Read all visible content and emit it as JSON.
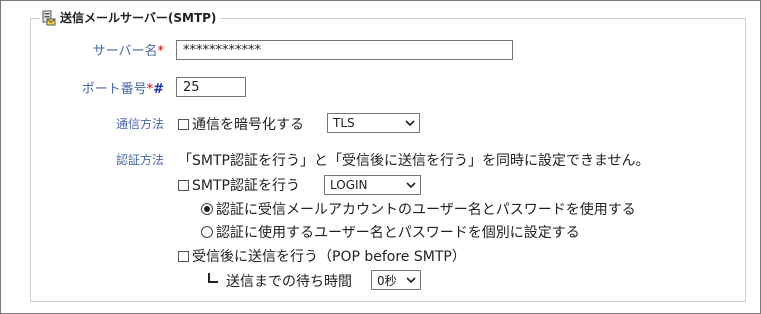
{
  "section": {
    "legend": "送信メールサーバー(SMTP)",
    "icon": "server-mail-icon"
  },
  "server_name": {
    "label": "サーバー名",
    "required_mark": "*",
    "value": "************"
  },
  "port": {
    "label": "ポート番号",
    "required_mark": "*",
    "hash_mark": "#",
    "value": "25"
  },
  "encryption": {
    "label": "通信方法",
    "checkbox_label": "通信を暗号化する",
    "checked": false,
    "select_value": "TLS"
  },
  "auth": {
    "label": "認証方法",
    "notice": "「SMTP認証を行う」と「受信後に送信を行う」を同時に設定できません。",
    "smtp_auth_label": "SMTP認証を行う",
    "smtp_auth_checked": false,
    "smtp_auth_select": "LOGIN",
    "radio_use_receive_account": "認証に受信メールアカウントのユーザー名とパスワードを使用する",
    "radio_use_separate": "認証に使用するユーザー名とパスワードを個別に設定する",
    "selected_radio": "use_receive_account",
    "pop_before_smtp_label": "受信後に送信を行う（POP before SMTP）",
    "pop_before_smtp_checked": false,
    "wait_label": "送信までの待ち時間",
    "wait_select": "0秒"
  }
}
